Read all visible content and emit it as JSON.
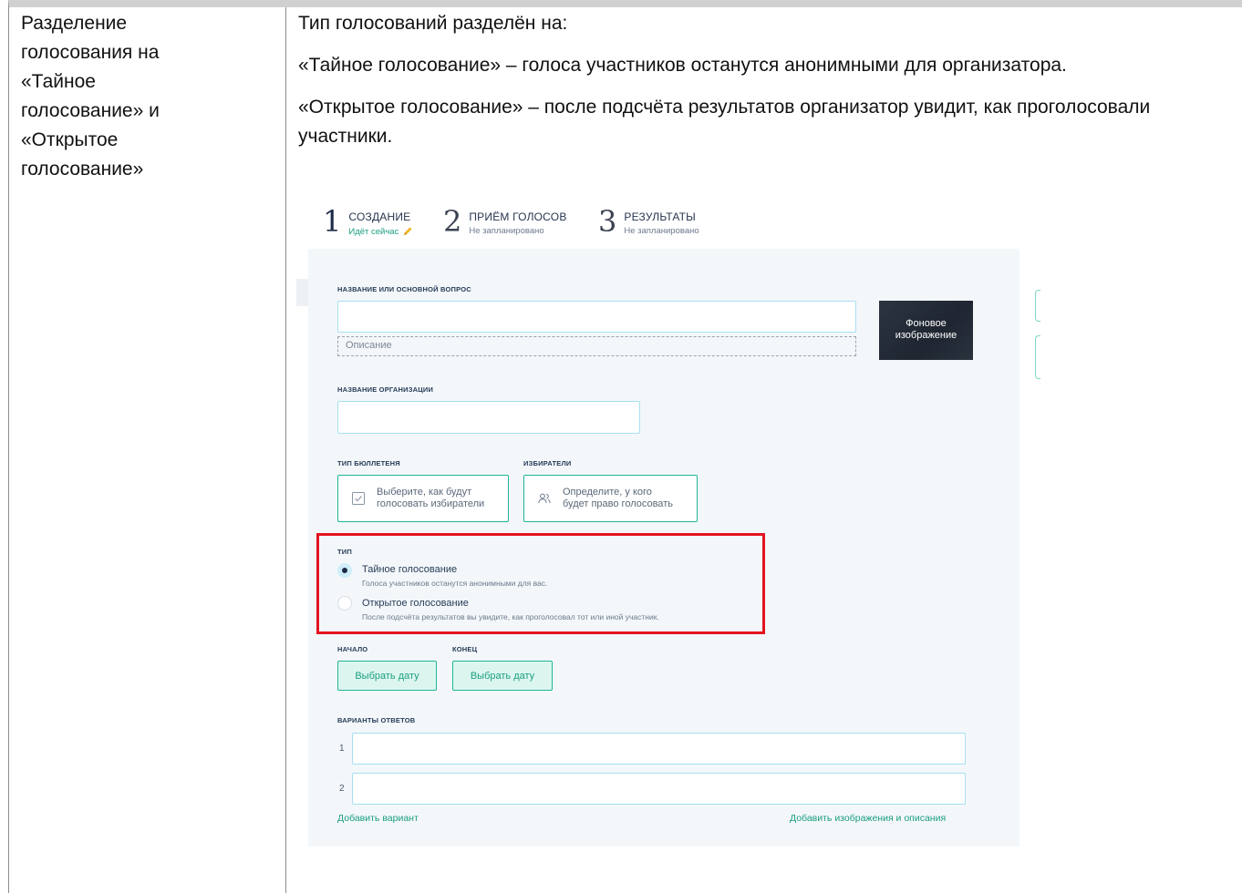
{
  "left_cell": {
    "lines": [
      "Разделение",
      "голосования на",
      "«Тайное",
      "голосование» и",
      "«Открытое",
      "голосование»"
    ]
  },
  "right_cell": {
    "intro": "Тип голосований разделён на:",
    "secret": {
      "term": "«Тайное голосование»",
      "desc": " – голоса участников останутся анонимными для организатора."
    },
    "open": {
      "term": "«Открытое голосование»",
      "desc": " – после подсчёта результатов организатор увидит, как проголосовали участники."
    }
  },
  "screenshot": {
    "steps": [
      {
        "num": "1",
        "title": "СОЗДАНИЕ",
        "sub": "Идёт сейчас"
      },
      {
        "num": "2",
        "title": "ПРИЁМ ГОЛОСОВ",
        "sub": "Не запланировано"
      },
      {
        "num": "3",
        "title": "РЕЗУЛЬТАТЫ",
        "sub": "Не запланировано"
      }
    ],
    "title_label": "НАЗВАНИЕ ИЛИ ОСНОВНОЙ ВОПРОС",
    "title_value": "",
    "description_placeholder": "Описание",
    "background_image_label": "Фоновое изображение",
    "background_image_line1": "Фоновое",
    "background_image_line2": "изображение",
    "org_label": "НАЗВАНИЕ ОРГАНИЗАЦИИ",
    "org_value": "",
    "ballot_label": "ТИП БЮЛЛЕТЕНЯ",
    "ballot_line1": "Выберите, как будут",
    "ballot_line2": "голосовать избиратели",
    "voters_label": "ИЗБИРАТЕЛИ",
    "voters_line1": "Определите, у кого",
    "voters_line2": "будет право голосовать",
    "type_label": "ТИП",
    "type_options": [
      {
        "title": "Тайное голосование",
        "sub": "Голоса участников останутся анонимными для вас.",
        "selected": true
      },
      {
        "title": "Открытое голосование",
        "sub": "После подсчёта результатов вы увидите, как проголосовал тот или иной участник.",
        "selected": false
      }
    ],
    "start_label": "НАЧАЛО",
    "end_label": "КОНЕЦ",
    "pick_date": "Выбрать дату",
    "answers_label": "ВАРИАНТЫ ОТВЕТОВ",
    "answers": [
      {
        "num": "1",
        "value": ""
      },
      {
        "num": "2",
        "value": ""
      }
    ],
    "add_option": "Добавить вариант",
    "add_images": "Добавить изображения и описания"
  },
  "colors": {
    "accent": "#1fb597",
    "highlight": "#e3141f",
    "panel": "#f3f7fa",
    "input_border": "#a7dff0"
  }
}
